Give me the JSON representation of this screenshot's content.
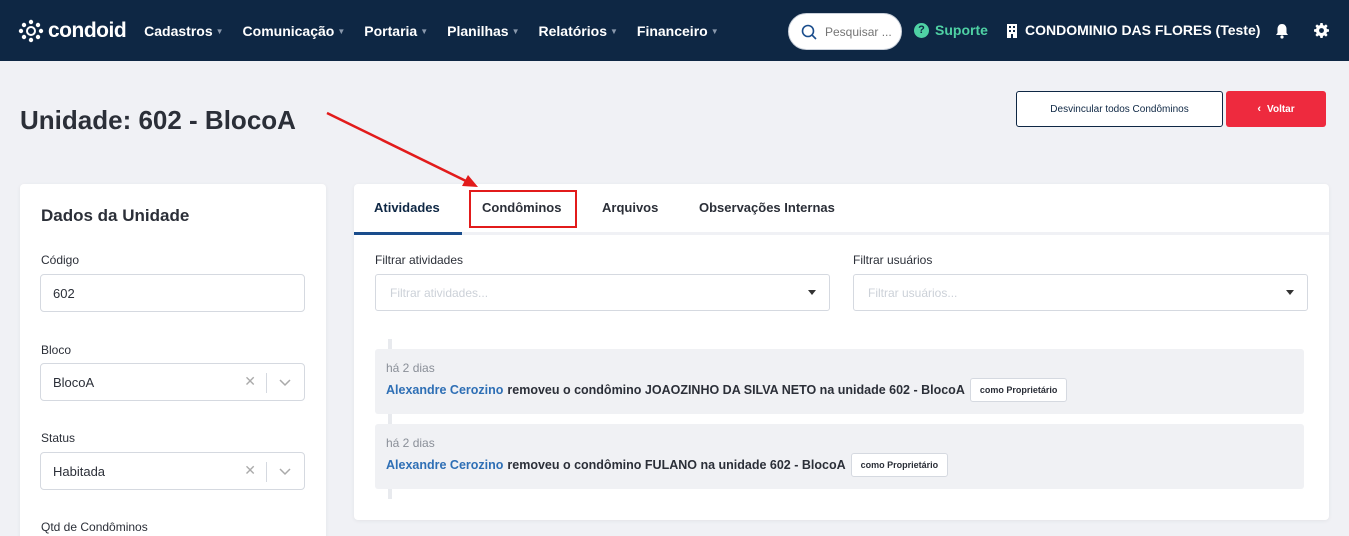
{
  "nav": {
    "logo": "condoid",
    "menu": [
      {
        "label": "Cadastros"
      },
      {
        "label": "Comunicação"
      },
      {
        "label": "Portaria"
      },
      {
        "label": "Planilhas"
      },
      {
        "label": "Relatórios"
      },
      {
        "label": "Financeiro"
      }
    ],
    "search_placeholder": "Pesquisar ...",
    "support_label": "Suporte",
    "condo_name": "CONDOMINIO DAS FLORES (Teste)"
  },
  "header": {
    "title": "Unidade: 602 - BlocoA",
    "unlink_button": "Desvincular todos Condôminos",
    "back_button": "Voltar"
  },
  "unit_card": {
    "title": "Dados da Unidade",
    "fields": {
      "codigo_label": "Código",
      "codigo_value": "602",
      "bloco_label": "Bloco",
      "bloco_value": "BlocoA",
      "status_label": "Status",
      "status_value": "Habitada",
      "qtd_label": "Qtd de Condôminos"
    }
  },
  "tabs": [
    {
      "label": "Atividades",
      "active": true
    },
    {
      "label": "Condôminos",
      "active": false
    },
    {
      "label": "Arquivos",
      "active": false
    },
    {
      "label": "Observações Internas",
      "active": false
    }
  ],
  "filters": {
    "activities_label": "Filtrar atividades",
    "activities_placeholder": "Filtrar atividades...",
    "users_label": "Filtrar usuários",
    "users_placeholder": "Filtrar usuários..."
  },
  "activities": [
    {
      "when": "há 2 dias",
      "user": "Alexandre Cerozino",
      "text": "removeu o condômino JOAOZINHO DA SILVA NETO na unidade 602 - BlocoA",
      "badge": "como Proprietário"
    },
    {
      "when": "há 2 dias",
      "user": "Alexandre Cerozino",
      "text": "removeu o condômino FULANO na unidade 602 - BlocoA",
      "badge": "como Proprietário"
    }
  ],
  "colors": {
    "nav_bg": "#0e2744",
    "accent_red": "#ee2a3e",
    "support_green": "#4fd1a4",
    "link_blue": "#2e6fb5",
    "annotation_red": "#e21b1b"
  }
}
